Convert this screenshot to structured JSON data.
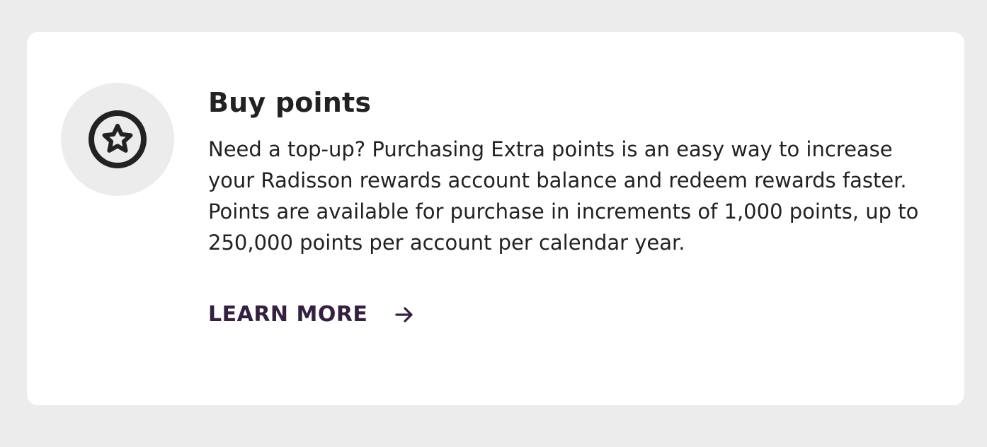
{
  "card": {
    "icon": "star-badge-icon",
    "title": "Buy points",
    "description": "Need a top-up? Purchasing Extra points is an easy way to increase your Radisson rewards account balance and redeem rewards faster. Points are available for purchase in increments of 1,000 points, up to 250,000 points per account per calendar year.",
    "link": {
      "label": "LEARN MORE",
      "icon": "arrow-right-icon"
    }
  },
  "colors": {
    "page_background": "#ececec",
    "card_background": "#ffffff",
    "icon_circle": "#ececec",
    "text": "#222222",
    "link": "#34203f"
  }
}
